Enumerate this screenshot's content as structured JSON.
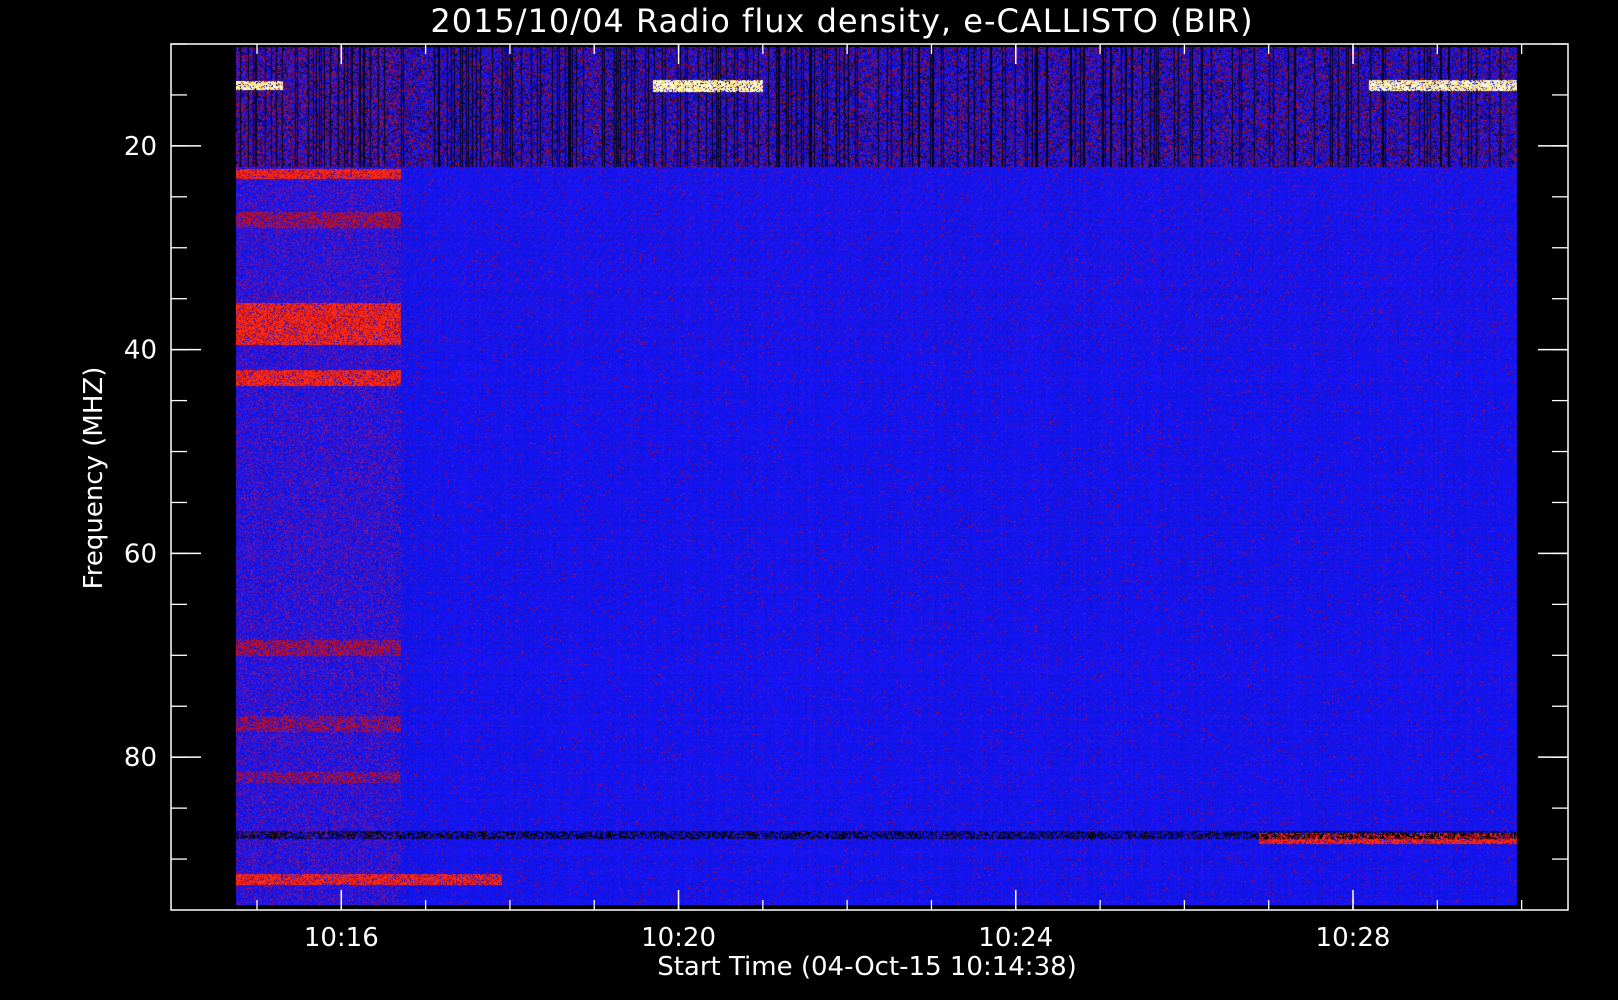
{
  "chart_data": {
    "type": "heatmap",
    "title": "2015/10/04  Radio flux density, e-CALLISTO (BIR)",
    "xlabel": "Start Time (04-Oct-15 10:14:38)",
    "ylabel": "Frequency (MHZ)",
    "x_unit": "minutes after 10:00 UT",
    "xlim": [
      13.98,
      30.55
    ],
    "ylim": [
      95,
      10
    ],
    "data_x_range": [
      14.75,
      29.95
    ],
    "data_y_range": [
      10.3,
      94.5
    ],
    "x_ticks": [
      {
        "value": 16,
        "label": "10:16"
      },
      {
        "value": 20,
        "label": "10:20"
      },
      {
        "value": 24,
        "label": "10:24"
      },
      {
        "value": 28,
        "label": "10:28"
      }
    ],
    "x_minor_step": 1,
    "y_ticks": [
      {
        "value": 20,
        "label": "20"
      },
      {
        "value": 40,
        "label": "40"
      },
      {
        "value": 60,
        "label": "60"
      },
      {
        "value": 80,
        "label": "80"
      }
    ],
    "y_minor_step": 5,
    "colormap": [
      "#000000",
      "#0a0af0",
      "#c0101a",
      "#ff2a10",
      "#ffd040",
      "#ffffe0"
    ],
    "background_color": "#1414ee",
    "features": [
      {
        "t_start": 14.75,
        "t_end": 29.95,
        "f_low": 10.3,
        "f_high": 22,
        "level": "mixed",
        "description": "noisy interference band"
      },
      {
        "t_start": 14.75,
        "t_end": 16.7,
        "f_low": 35.5,
        "f_high": 39.5,
        "level": "high"
      },
      {
        "t_start": 14.75,
        "t_end": 16.7,
        "f_low": 42,
        "f_high": 43.5,
        "level": "high"
      },
      {
        "t_start": 14.75,
        "t_end": 16.7,
        "f_low": 22.3,
        "f_high": 23.2,
        "level": "high"
      },
      {
        "t_start": 14.75,
        "t_end": 16.7,
        "f_low": 26.5,
        "f_high": 28,
        "level": "medium"
      },
      {
        "t_start": 14.75,
        "t_end": 16.7,
        "f_low": 68.5,
        "f_high": 70,
        "level": "medium"
      },
      {
        "t_start": 14.75,
        "t_end": 16.7,
        "f_low": 76,
        "f_high": 77.5,
        "level": "low"
      },
      {
        "t_start": 14.75,
        "t_end": 16.7,
        "f_low": 81.5,
        "f_high": 82.5,
        "level": "low"
      },
      {
        "t_start": 14.75,
        "t_end": 17.9,
        "f_low": 91.5,
        "f_high": 92.5,
        "level": "high"
      },
      {
        "t_start": 19.7,
        "t_end": 21,
        "f_low": 13.6,
        "f_high": 14.7,
        "level": "saturated"
      },
      {
        "t_start": 14.75,
        "t_end": 15.3,
        "f_low": 13.7,
        "f_high": 14.5,
        "level": "saturated"
      },
      {
        "t_start": 28.2,
        "t_end": 29.95,
        "f_low": 13.6,
        "f_high": 14.6,
        "level": "saturated"
      },
      {
        "t_start": 26.9,
        "t_end": 29.95,
        "f_low": 87.5,
        "f_high": 88.5,
        "level": "high"
      },
      {
        "t_start": 14.75,
        "t_end": 29.95,
        "f_low": 87.3,
        "f_high": 88,
        "level": "absorption"
      }
    ]
  }
}
